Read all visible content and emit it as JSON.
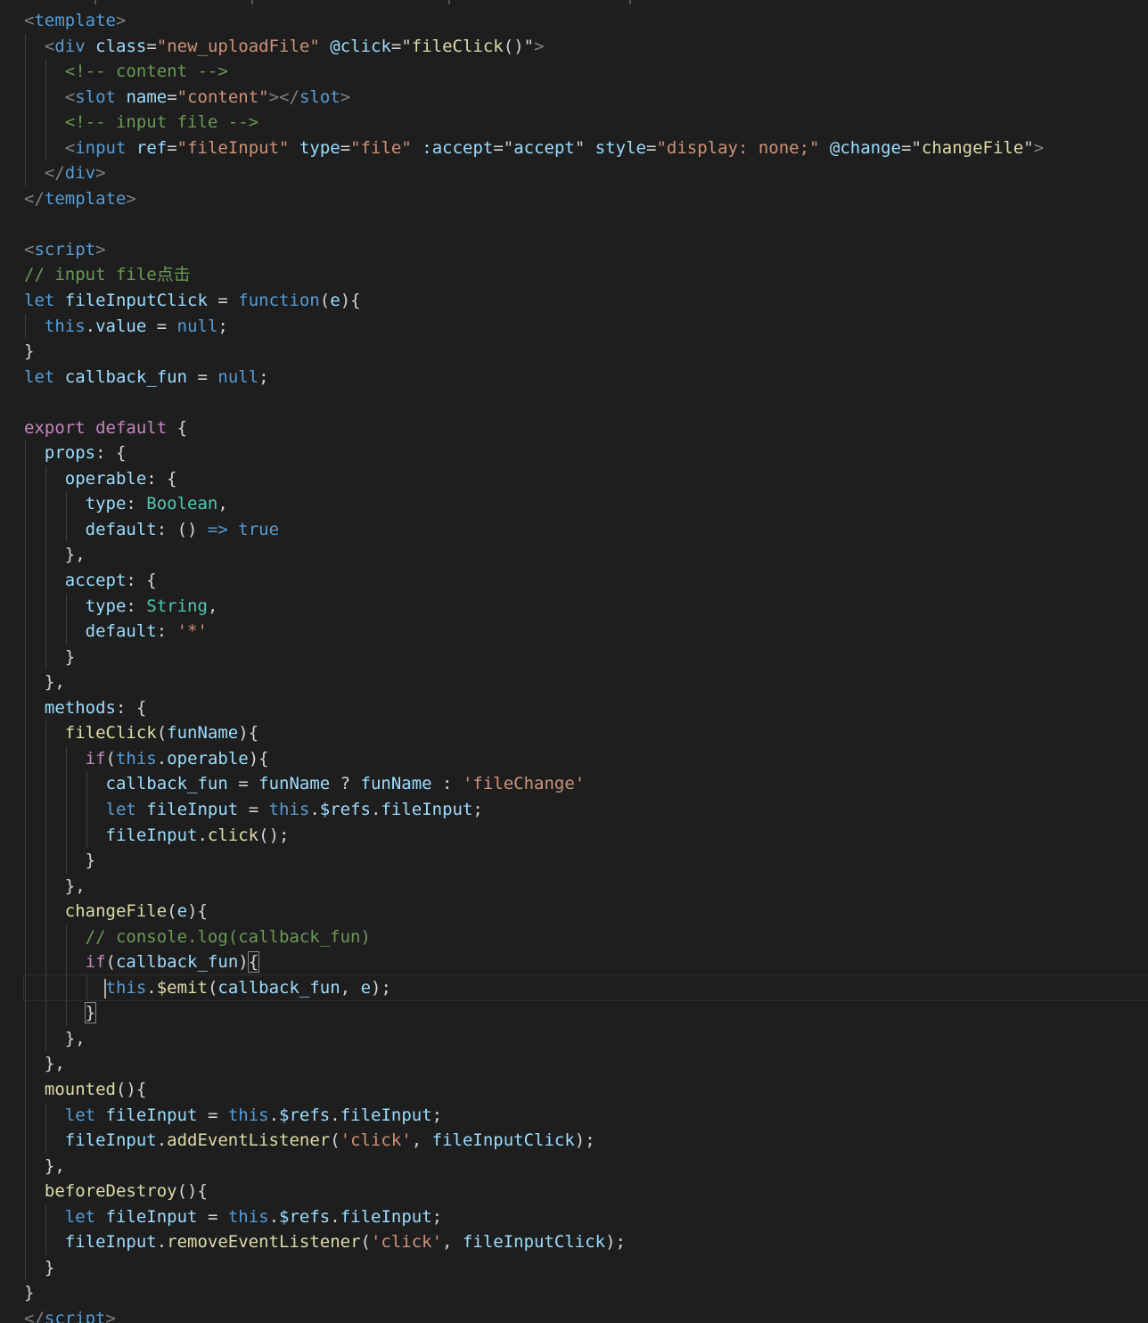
{
  "colors": {
    "background": "#1e1e1e",
    "default": "#d4d4d4",
    "tag": "#569cd6",
    "tagBracket": "#808080",
    "attr": "#9cdcfe",
    "string": "#ce9178",
    "comment": "#6a9955",
    "keywordBlue": "#569cd6",
    "keywordPurple": "#c586c0",
    "variable": "#9cdcfe",
    "function": "#dcdcaa",
    "type": "#4ec9b0"
  },
  "lines": [
    {
      "indent": 0,
      "tokens": [
        {
          "t": "<",
          "c": "tagBracket"
        },
        {
          "t": "template",
          "c": "tag"
        },
        {
          "t": ">",
          "c": "tagBracket"
        }
      ]
    },
    {
      "indent": 1,
      "tokens": [
        {
          "t": "<",
          "c": "tagBracket"
        },
        {
          "t": "div",
          "c": "tag"
        },
        {
          "t": " "
        },
        {
          "t": "class",
          "c": "attr"
        },
        {
          "t": "="
        },
        {
          "t": "\"new_uploadFile\"",
          "c": "string"
        },
        {
          "t": " "
        },
        {
          "t": "@click",
          "c": "attr"
        },
        {
          "t": "=\""
        },
        {
          "t": "fileClick",
          "c": "function"
        },
        {
          "t": "()\""
        },
        {
          "t": ">",
          "c": "tagBracket"
        }
      ]
    },
    {
      "indent": 2,
      "tokens": [
        {
          "t": "<!-- content -->",
          "c": "comment"
        }
      ]
    },
    {
      "indent": 2,
      "tokens": [
        {
          "t": "<",
          "c": "tagBracket"
        },
        {
          "t": "slot",
          "c": "tag"
        },
        {
          "t": " "
        },
        {
          "t": "name",
          "c": "attr"
        },
        {
          "t": "="
        },
        {
          "t": "\"content\"",
          "c": "string"
        },
        {
          "t": "></",
          "c": "tagBracket"
        },
        {
          "t": "slot",
          "c": "tag"
        },
        {
          "t": ">",
          "c": "tagBracket"
        }
      ]
    },
    {
      "indent": 2,
      "tokens": [
        {
          "t": "<!-- input file -->",
          "c": "comment"
        }
      ]
    },
    {
      "indent": 2,
      "tokens": [
        {
          "t": "<",
          "c": "tagBracket"
        },
        {
          "t": "input",
          "c": "tag"
        },
        {
          "t": " "
        },
        {
          "t": "ref",
          "c": "attr"
        },
        {
          "t": "="
        },
        {
          "t": "\"fileInput\"",
          "c": "string"
        },
        {
          "t": " "
        },
        {
          "t": "type",
          "c": "attr"
        },
        {
          "t": "="
        },
        {
          "t": "\"file\"",
          "c": "string"
        },
        {
          "t": " "
        },
        {
          "t": ":accept",
          "c": "attr"
        },
        {
          "t": "=\""
        },
        {
          "t": "accept",
          "c": "variable"
        },
        {
          "t": "\""
        },
        {
          "t": " "
        },
        {
          "t": "style",
          "c": "attr"
        },
        {
          "t": "="
        },
        {
          "t": "\"display: none;\"",
          "c": "string"
        },
        {
          "t": " "
        },
        {
          "t": "@change",
          "c": "attr"
        },
        {
          "t": "=\""
        },
        {
          "t": "changeFile",
          "c": "function"
        },
        {
          "t": "\""
        },
        {
          "t": ">",
          "c": "tagBracket"
        }
      ]
    },
    {
      "indent": 1,
      "tokens": [
        {
          "t": "</",
          "c": "tagBracket"
        },
        {
          "t": "div",
          "c": "tag"
        },
        {
          "t": ">",
          "c": "tagBracket"
        }
      ]
    },
    {
      "indent": 0,
      "tokens": [
        {
          "t": "</",
          "c": "tagBracket"
        },
        {
          "t": "template",
          "c": "tag"
        },
        {
          "t": ">",
          "c": "tagBracket"
        }
      ]
    },
    {
      "indent": 0,
      "tokens": []
    },
    {
      "indent": 0,
      "tokens": [
        {
          "t": "<",
          "c": "tagBracket"
        },
        {
          "t": "script",
          "c": "tag"
        },
        {
          "t": ">",
          "c": "tagBracket"
        }
      ]
    },
    {
      "indent": 0,
      "tokens": [
        {
          "t": "// input file点击",
          "c": "comment"
        }
      ]
    },
    {
      "indent": 0,
      "tokens": [
        {
          "t": "let",
          "c": "keywordBlue"
        },
        {
          "t": " "
        },
        {
          "t": "fileInputClick",
          "c": "variable"
        },
        {
          "t": " = "
        },
        {
          "t": "function",
          "c": "keywordBlue"
        },
        {
          "t": "("
        },
        {
          "t": "e",
          "c": "variable"
        },
        {
          "t": "){"
        }
      ]
    },
    {
      "indent": 1,
      "tokens": [
        {
          "t": "this",
          "c": "keywordBlue"
        },
        {
          "t": "."
        },
        {
          "t": "value",
          "c": "variable"
        },
        {
          "t": " = "
        },
        {
          "t": "null",
          "c": "keywordBlue"
        },
        {
          "t": ";"
        }
      ]
    },
    {
      "indent": 0,
      "tokens": [
        {
          "t": "}"
        }
      ]
    },
    {
      "indent": 0,
      "tokens": [
        {
          "t": "let",
          "c": "keywordBlue"
        },
        {
          "t": " "
        },
        {
          "t": "callback_fun",
          "c": "variable"
        },
        {
          "t": " = "
        },
        {
          "t": "null",
          "c": "keywordBlue"
        },
        {
          "t": ";"
        }
      ]
    },
    {
      "indent": 0,
      "tokens": []
    },
    {
      "indent": 0,
      "tokens": [
        {
          "t": "export",
          "c": "keywordPurple"
        },
        {
          "t": " "
        },
        {
          "t": "default",
          "c": "keywordPurple"
        },
        {
          "t": " {"
        }
      ]
    },
    {
      "indent": 1,
      "tokens": [
        {
          "t": "props",
          "c": "variable"
        },
        {
          "t": ": {"
        }
      ]
    },
    {
      "indent": 2,
      "tokens": [
        {
          "t": "operable",
          "c": "variable"
        },
        {
          "t": ": {"
        }
      ]
    },
    {
      "indent": 3,
      "tokens": [
        {
          "t": "type",
          "c": "variable"
        },
        {
          "t": ": "
        },
        {
          "t": "Boolean",
          "c": "type"
        },
        {
          "t": ","
        }
      ]
    },
    {
      "indent": 3,
      "tokens": [
        {
          "t": "default",
          "c": "variable"
        },
        {
          "t": ": () "
        },
        {
          "t": "=>",
          "c": "keywordBlue"
        },
        {
          "t": " "
        },
        {
          "t": "true",
          "c": "keywordBlue"
        }
      ]
    },
    {
      "indent": 2,
      "tokens": [
        {
          "t": "},"
        }
      ]
    },
    {
      "indent": 2,
      "tokens": [
        {
          "t": "accept",
          "c": "variable"
        },
        {
          "t": ": {"
        }
      ]
    },
    {
      "indent": 3,
      "tokens": [
        {
          "t": "type",
          "c": "variable"
        },
        {
          "t": ": "
        },
        {
          "t": "String",
          "c": "type"
        },
        {
          "t": ","
        }
      ]
    },
    {
      "indent": 3,
      "tokens": [
        {
          "t": "default",
          "c": "variable"
        },
        {
          "t": ": "
        },
        {
          "t": "'*'",
          "c": "string"
        }
      ]
    },
    {
      "indent": 2,
      "tokens": [
        {
          "t": "}"
        }
      ]
    },
    {
      "indent": 1,
      "tokens": [
        {
          "t": "},"
        }
      ]
    },
    {
      "indent": 1,
      "tokens": [
        {
          "t": "methods",
          "c": "variable"
        },
        {
          "t": ": {"
        }
      ]
    },
    {
      "indent": 2,
      "tokens": [
        {
          "t": "fileClick",
          "c": "function"
        },
        {
          "t": "("
        },
        {
          "t": "funName",
          "c": "variable"
        },
        {
          "t": "){"
        }
      ]
    },
    {
      "indent": 3,
      "tokens": [
        {
          "t": "if",
          "c": "keywordPurple"
        },
        {
          "t": "("
        },
        {
          "t": "this",
          "c": "keywordBlue"
        },
        {
          "t": "."
        },
        {
          "t": "operable",
          "c": "variable"
        },
        {
          "t": "){"
        }
      ]
    },
    {
      "indent": 4,
      "tokens": [
        {
          "t": "callback_fun",
          "c": "variable"
        },
        {
          "t": " = "
        },
        {
          "t": "funName",
          "c": "variable"
        },
        {
          "t": " ? "
        },
        {
          "t": "funName",
          "c": "variable"
        },
        {
          "t": " : "
        },
        {
          "t": "'fileChange'",
          "c": "string"
        }
      ]
    },
    {
      "indent": 4,
      "tokens": [
        {
          "t": "let",
          "c": "keywordBlue"
        },
        {
          "t": " "
        },
        {
          "t": "fileInput",
          "c": "variable"
        },
        {
          "t": " = "
        },
        {
          "t": "this",
          "c": "keywordBlue"
        },
        {
          "t": "."
        },
        {
          "t": "$refs",
          "c": "variable"
        },
        {
          "t": "."
        },
        {
          "t": "fileInput",
          "c": "variable"
        },
        {
          "t": ";"
        }
      ]
    },
    {
      "indent": 4,
      "tokens": [
        {
          "t": "fileInput",
          "c": "variable"
        },
        {
          "t": "."
        },
        {
          "t": "click",
          "c": "function"
        },
        {
          "t": "();"
        }
      ]
    },
    {
      "indent": 3,
      "tokens": [
        {
          "t": "}"
        }
      ]
    },
    {
      "indent": 2,
      "tokens": [
        {
          "t": "},"
        }
      ]
    },
    {
      "indent": 2,
      "tokens": [
        {
          "t": "changeFile",
          "c": "function"
        },
        {
          "t": "("
        },
        {
          "t": "e",
          "c": "variable"
        },
        {
          "t": "){"
        }
      ]
    },
    {
      "indent": 3,
      "tokens": [
        {
          "t": "// console.log(callback_fun)",
          "c": "comment"
        }
      ]
    },
    {
      "indent": 3,
      "tokens": [
        {
          "t": "if",
          "c": "keywordPurple"
        },
        {
          "t": "("
        },
        {
          "t": "callback_fun",
          "c": "variable"
        },
        {
          "t": ")"
        },
        {
          "t": "{",
          "match": true
        }
      ]
    },
    {
      "indent": 4,
      "current": true,
      "tokens": [
        {
          "t": "this",
          "c": "keywordBlue"
        },
        {
          "t": "."
        },
        {
          "t": "$emit",
          "c": "function"
        },
        {
          "t": "("
        },
        {
          "t": "callback_fun",
          "c": "variable"
        },
        {
          "t": ", "
        },
        {
          "t": "e",
          "c": "variable"
        },
        {
          "t": ");"
        }
      ]
    },
    {
      "indent": 3,
      "tokens": [
        {
          "t": "}",
          "match": true
        }
      ]
    },
    {
      "indent": 2,
      "tokens": [
        {
          "t": "},"
        }
      ]
    },
    {
      "indent": 1,
      "tokens": [
        {
          "t": "},"
        }
      ]
    },
    {
      "indent": 1,
      "tokens": [
        {
          "t": "mounted",
          "c": "function"
        },
        {
          "t": "(){"
        }
      ]
    },
    {
      "indent": 2,
      "tokens": [
        {
          "t": "let",
          "c": "keywordBlue"
        },
        {
          "t": " "
        },
        {
          "t": "fileInput",
          "c": "variable"
        },
        {
          "t": " = "
        },
        {
          "t": "this",
          "c": "keywordBlue"
        },
        {
          "t": "."
        },
        {
          "t": "$refs",
          "c": "variable"
        },
        {
          "t": "."
        },
        {
          "t": "fileInput",
          "c": "variable"
        },
        {
          "t": ";"
        }
      ]
    },
    {
      "indent": 2,
      "tokens": [
        {
          "t": "fileInput",
          "c": "variable"
        },
        {
          "t": "."
        },
        {
          "t": "addEventListener",
          "c": "function"
        },
        {
          "t": "("
        },
        {
          "t": "'click'",
          "c": "string"
        },
        {
          "t": ", "
        },
        {
          "t": "fileInputClick",
          "c": "variable"
        },
        {
          "t": ");"
        }
      ]
    },
    {
      "indent": 1,
      "tokens": [
        {
          "t": "},"
        }
      ]
    },
    {
      "indent": 1,
      "tokens": [
        {
          "t": "beforeDestroy",
          "c": "function"
        },
        {
          "t": "(){"
        }
      ]
    },
    {
      "indent": 2,
      "tokens": [
        {
          "t": "let",
          "c": "keywordBlue"
        },
        {
          "t": " "
        },
        {
          "t": "fileInput",
          "c": "variable"
        },
        {
          "t": " = "
        },
        {
          "t": "this",
          "c": "keywordBlue"
        },
        {
          "t": "."
        },
        {
          "t": "$refs",
          "c": "variable"
        },
        {
          "t": "."
        },
        {
          "t": "fileInput",
          "c": "variable"
        },
        {
          "t": ";"
        }
      ]
    },
    {
      "indent": 2,
      "tokens": [
        {
          "t": "fileInput",
          "c": "variable"
        },
        {
          "t": "."
        },
        {
          "t": "removeEventListener",
          "c": "function"
        },
        {
          "t": "("
        },
        {
          "t": "'click'",
          "c": "string"
        },
        {
          "t": ", "
        },
        {
          "t": "fileInputClick",
          "c": "variable"
        },
        {
          "t": ");"
        }
      ]
    },
    {
      "indent": 1,
      "tokens": [
        {
          "t": "}"
        }
      ]
    },
    {
      "indent": 0,
      "tokens": [
        {
          "t": "}"
        }
      ]
    },
    {
      "indent": 0,
      "tokens": [
        {
          "t": "</",
          "c": "tagBracket"
        },
        {
          "t": "script",
          "c": "tag"
        },
        {
          "t": ">",
          "c": "tagBracket"
        }
      ]
    }
  ]
}
